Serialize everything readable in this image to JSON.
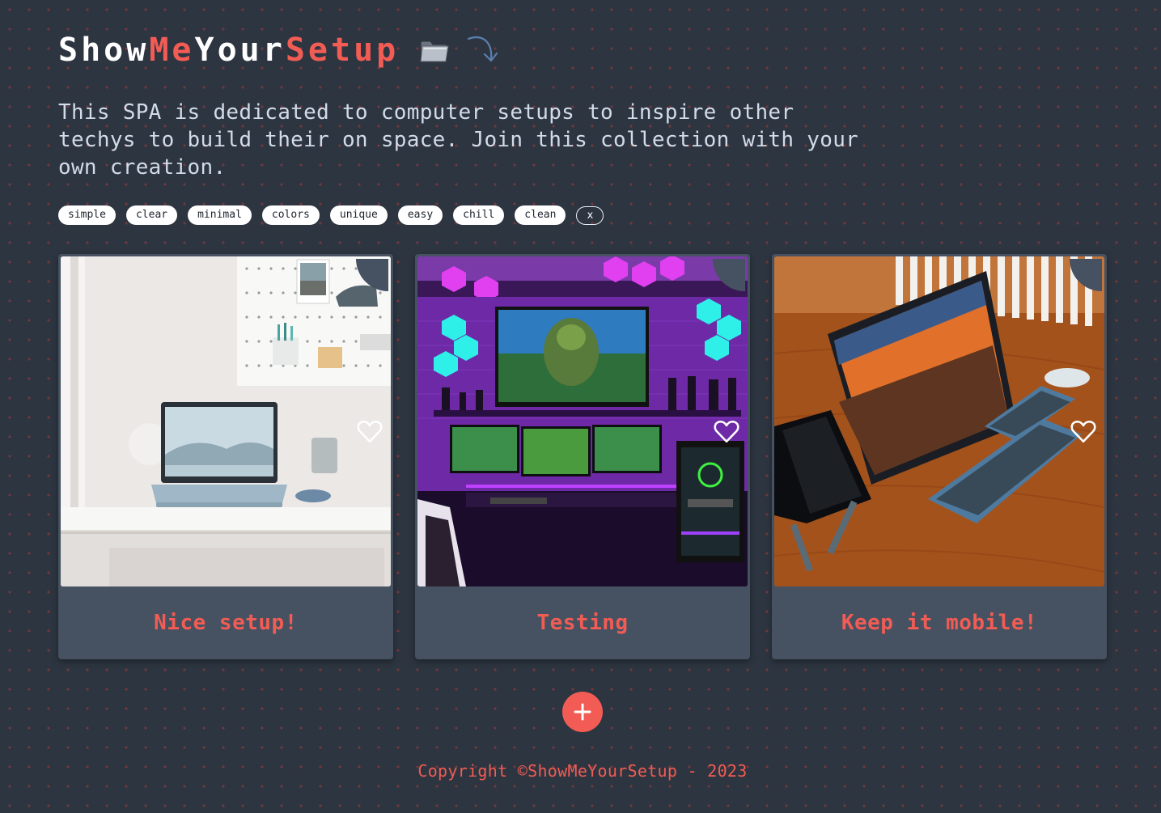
{
  "brand": {
    "part1": "Show",
    "part2": "Me",
    "part3": "Your",
    "part4": "Setup",
    "icon": "folder-icon",
    "arrow_icon": "curved-arrow-icon"
  },
  "description": "This SPA is dedicated to computer setups to inspire other techys to build their on space. Join this collection with your own creation.",
  "tags": [
    "simple",
    "clear",
    "minimal",
    "colors",
    "unique",
    "easy",
    "chill",
    "clean"
  ],
  "clear_tag_label": "x",
  "cards": [
    {
      "title": "Nice setup!",
      "favorite_icon": "heart-outline-icon"
    },
    {
      "title": "Testing",
      "favorite_icon": "heart-outline-icon"
    },
    {
      "title": "Keep it mobile!",
      "favorite_icon": "heart-outline-icon"
    }
  ],
  "add_button": {
    "icon": "plus-icon"
  },
  "footer": {
    "copyright": "Copyright ©ShowMeYourSetup - 2023"
  },
  "colors": {
    "background": "#2d3540",
    "card": "#465261",
    "accent": "#f25c54",
    "text": "#d2dbe8"
  }
}
